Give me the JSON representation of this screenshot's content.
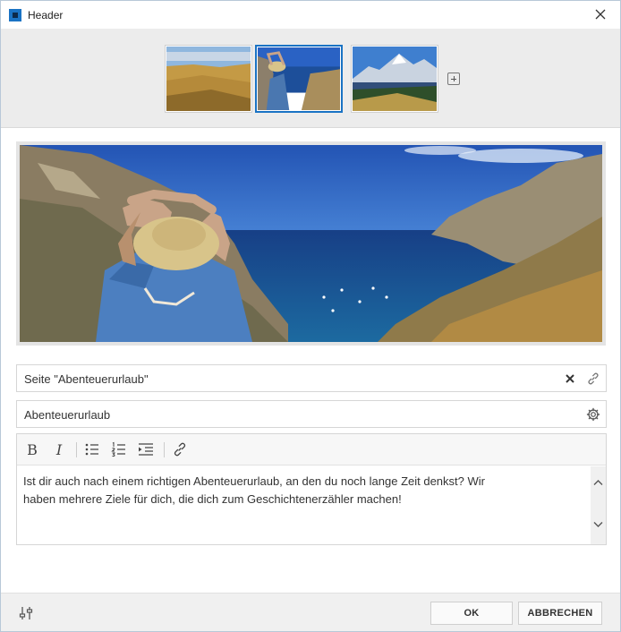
{
  "window": {
    "title": "Header"
  },
  "thumbnails": [
    {
      "name": "steppe-landscape",
      "selected": false
    },
    {
      "name": "woman-at-sea-bay",
      "selected": true
    },
    {
      "name": "mountain-lake",
      "selected": false
    }
  ],
  "page_link": {
    "value": "Seite \"Abenteuerurlaub\""
  },
  "heading": {
    "value": "Abenteuerurlaub"
  },
  "editor": {
    "tools": [
      "bold",
      "italic",
      "bullet-list",
      "numbered-list",
      "indent",
      "link"
    ],
    "bold_label": "B",
    "italic_label": "I",
    "text_line1": "Ist dir auch nach einem richtigen Abenteuerurlaub, an den du noch lange Zeit denkst? Wir",
    "text_line2": "haben mehrere Ziele für dich, die dich zum Geschichtenerzähler machen!"
  },
  "footer": {
    "ok_label": "OK",
    "cancel_label": "ABBRECHEN"
  },
  "colors": {
    "accent": "#1a73c4",
    "sea": "#1d4f9a",
    "sky": "#2a62c4"
  }
}
